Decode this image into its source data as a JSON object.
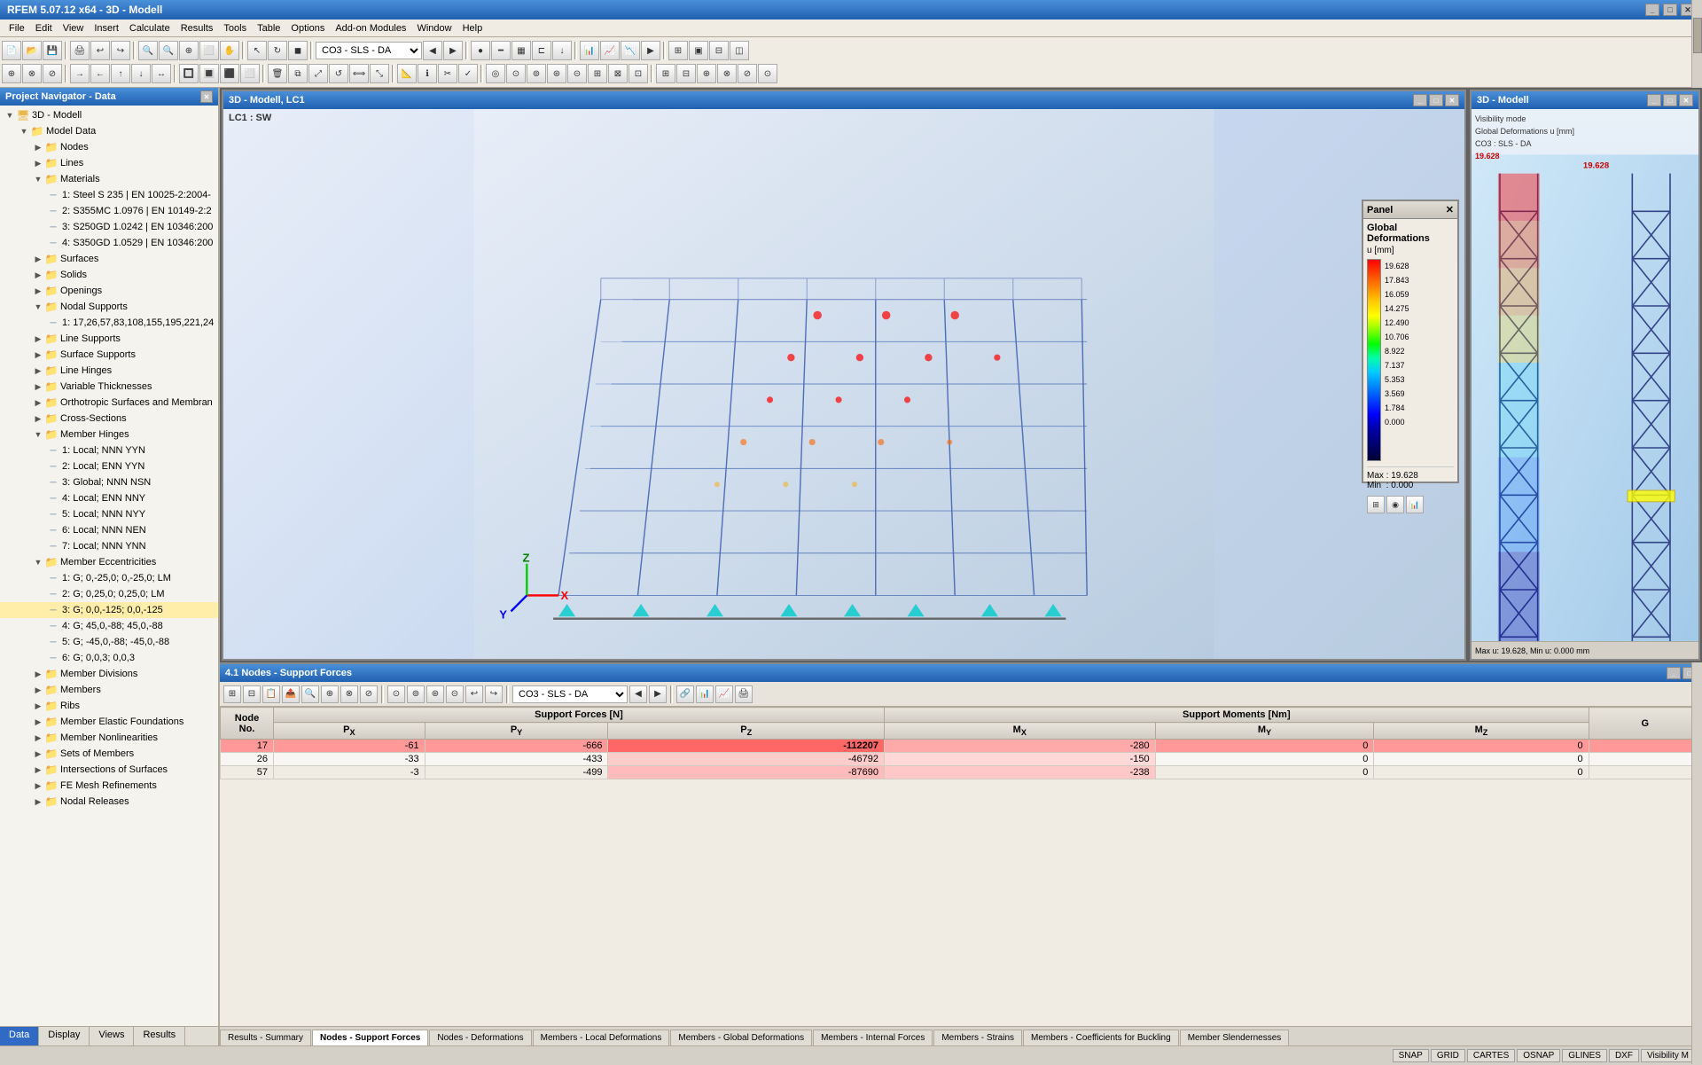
{
  "titlebar": {
    "title": "RFEM 5.07.12 x64 - 3D - Modell",
    "buttons": [
      "_",
      "□",
      "✕"
    ]
  },
  "menu": {
    "items": [
      "File",
      "Edit",
      "View",
      "Insert",
      "Calculate",
      "Results",
      "Tools",
      "Table",
      "Options",
      "Add-on Modules",
      "Window",
      "Help"
    ]
  },
  "toolbar": {
    "combo1": "CO3 - SLS - DA"
  },
  "project_navigator": {
    "title": "Project Navigator - Data",
    "tree": [
      {
        "level": 0,
        "type": "root",
        "label": "3D - Modell",
        "expanded": true
      },
      {
        "level": 1,
        "type": "folder",
        "label": "Model Data",
        "expanded": true
      },
      {
        "level": 2,
        "type": "folder",
        "label": "Nodes",
        "expanded": false
      },
      {
        "level": 2,
        "type": "folder",
        "label": "Lines",
        "expanded": false
      },
      {
        "level": 2,
        "type": "folder",
        "label": "Materials",
        "expanded": true
      },
      {
        "level": 3,
        "type": "item",
        "label": "1: Steel S 235 | EN 10025-2:2004-"
      },
      {
        "level": 3,
        "type": "item",
        "label": "2: S355MC 1.0976 | EN 10149-2:2"
      },
      {
        "level": 3,
        "type": "item",
        "label": "3: S250GD 1.0242 | EN 10346:200"
      },
      {
        "level": 3,
        "type": "item",
        "label": "4: S350GD 1.0529 | EN 10346:200"
      },
      {
        "level": 2,
        "type": "folder",
        "label": "Surfaces",
        "expanded": false
      },
      {
        "level": 2,
        "type": "folder",
        "label": "Solids",
        "expanded": false
      },
      {
        "level": 2,
        "type": "folder",
        "label": "Openings",
        "expanded": false
      },
      {
        "level": 2,
        "type": "folder",
        "label": "Nodal Supports",
        "expanded": true
      },
      {
        "level": 3,
        "type": "item",
        "label": "1: 17,26,57,83,108,155,195,221,24"
      },
      {
        "level": 2,
        "type": "folder",
        "label": "Line Supports",
        "expanded": false
      },
      {
        "level": 2,
        "type": "folder",
        "label": "Surface Supports",
        "expanded": false
      },
      {
        "level": 2,
        "type": "folder",
        "label": "Line Hinges",
        "expanded": false
      },
      {
        "level": 2,
        "type": "folder",
        "label": "Variable Thicknesses",
        "expanded": false
      },
      {
        "level": 2,
        "type": "folder",
        "label": "Orthotropic Surfaces and Membran",
        "expanded": false
      },
      {
        "level": 2,
        "type": "folder",
        "label": "Cross-Sections",
        "expanded": false
      },
      {
        "level": 2,
        "type": "folder",
        "label": "Member Hinges",
        "expanded": true
      },
      {
        "level": 3,
        "type": "item",
        "label": "1: Local; NNN YYN"
      },
      {
        "level": 3,
        "type": "item",
        "label": "2: Local; ENN YYN"
      },
      {
        "level": 3,
        "type": "item",
        "label": "3: Global; NNN NSN"
      },
      {
        "level": 3,
        "type": "item",
        "label": "4: Local; ENN NNY"
      },
      {
        "level": 3,
        "type": "item",
        "label": "5: Local; NNN NYY"
      },
      {
        "level": 3,
        "type": "item",
        "label": "6: Local; NNN NEN"
      },
      {
        "level": 3,
        "type": "item",
        "label": "7: Local; NNN YNN"
      },
      {
        "level": 2,
        "type": "folder",
        "label": "Member Eccentricities",
        "expanded": true
      },
      {
        "level": 3,
        "type": "item",
        "label": "1: G; 0,-25,0; 0,-25,0; LM"
      },
      {
        "level": 3,
        "type": "item",
        "label": "2: G; 0,25,0; 0,25,0; LM"
      },
      {
        "level": 3,
        "type": "item",
        "label": "3: G; 0,0,-125; 0,0,-125",
        "highlighted": true
      },
      {
        "level": 3,
        "type": "item",
        "label": "4: G; 45,0,-88; 45,0,-88"
      },
      {
        "level": 3,
        "type": "item",
        "label": "5: G; -45,0,-88; -45,0,-88"
      },
      {
        "level": 3,
        "type": "item",
        "label": "6: G; 0,0,3; 0,0,3"
      },
      {
        "level": 2,
        "type": "folder",
        "label": "Member Divisions",
        "expanded": false
      },
      {
        "level": 2,
        "type": "folder",
        "label": "Members",
        "expanded": false
      },
      {
        "level": 2,
        "type": "folder",
        "label": "Ribs",
        "expanded": false
      },
      {
        "level": 2,
        "type": "folder",
        "label": "Member Elastic Foundations",
        "expanded": false
      },
      {
        "level": 2,
        "type": "folder",
        "label": "Member Nonlinearities",
        "expanded": false
      },
      {
        "level": 2,
        "type": "folder",
        "label": "Sets of Members",
        "expanded": false
      },
      {
        "level": 2,
        "type": "folder",
        "label": "Intersections of Surfaces",
        "expanded": false
      },
      {
        "level": 2,
        "type": "folder",
        "label": "FE Mesh Refinements",
        "expanded": false
      },
      {
        "level": 2,
        "type": "folder",
        "label": "Nodal Releases",
        "expanded": false
      }
    ],
    "tabs": [
      "Data",
      "Display",
      "Views",
      "Results"
    ]
  },
  "model3d_main": {
    "title": "3D - Modell, LC1",
    "lc_label": "LC1 : SW",
    "buttons": [
      "_",
      "□",
      "✕"
    ]
  },
  "panel": {
    "title": "Panel",
    "close": "✕",
    "subtitle": "Global Deformations",
    "unit": "u [mm]",
    "values": [
      "19.628",
      "17.843",
      "16.059",
      "14.275",
      "12.490",
      "10.706",
      "8.922",
      "7.137",
      "5.353",
      "3.569",
      "1.784",
      "0.000"
    ],
    "max_label": "Max",
    "max_val": "19.628",
    "min_label": "Min",
    "min_val": "0.000"
  },
  "model3d_right": {
    "title": "3D - Modell",
    "vis_line1": "Visibility mode",
    "vis_line2": "Global Deformations u [mm]",
    "vis_line3": "CO3 : SLS - DA",
    "gradient_top": "19.628",
    "buttons": [
      "_",
      "□",
      "✕"
    ]
  },
  "results": {
    "title": "4.1 Nodes - Support Forces",
    "toolbar_combo": "CO3 - SLS - DA",
    "columns": {
      "A": "Node No.",
      "B_header": "Support Forces [N]",
      "B": "Px",
      "C": "Py",
      "D": "Pz",
      "E_header": "Support Moments [Nm]",
      "E": "Mx",
      "F": "My",
      "G": "Mz",
      "H": "G"
    },
    "rows": [
      {
        "node": "17",
        "px": "-61",
        "py": "-666",
        "pz": "-112207",
        "mx": "-280",
        "my": "0",
        "mz": "0",
        "highlight": true
      },
      {
        "node": "26",
        "px": "-33",
        "py": "-433",
        "pz": "-46792",
        "mx": "-150",
        "my": "0",
        "mz": "0",
        "highlight": false
      },
      {
        "node": "57",
        "px": "-3",
        "py": "-499",
        "pz": "-87690",
        "mx": "-238",
        "my": "0",
        "mz": "0",
        "highlight": false
      }
    ],
    "tabs": [
      "Results - Summary",
      "Nodes - Support Forces",
      "Nodes - Deformations",
      "Members - Local Deformations",
      "Members - Global Deformations",
      "Members - Internal Forces",
      "Members - Strains",
      "Members - Coefficients for Buckling",
      "Member Slendernesses"
    ],
    "active_tab": "Nodes - Support Forces"
  },
  "statusbar": {
    "buttons": [
      "SNAP",
      "GRID",
      "CARTES",
      "OSNAP",
      "GLINES",
      "DXF",
      "Visibility M"
    ]
  }
}
